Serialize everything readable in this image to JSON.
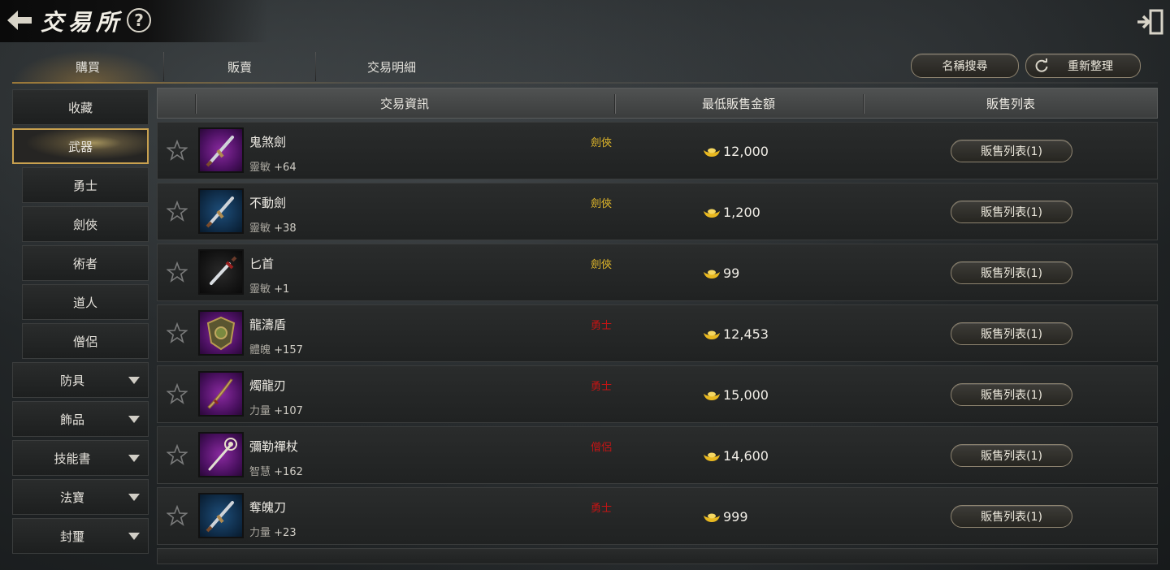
{
  "header": {
    "title": "交易所",
    "back_icon": "back-arrow-icon",
    "help_label": "?",
    "exit_icon": "exit-icon"
  },
  "tabs": [
    {
      "label": "購買",
      "active": true
    },
    {
      "label": "販賣",
      "active": false
    },
    {
      "label": "交易明細",
      "active": false
    }
  ],
  "actions": {
    "search_label": "名稱搜尋",
    "refresh_label": "重新整理",
    "refresh_icon": "refresh-icon"
  },
  "sidebar": {
    "items": [
      {
        "label": "收藏",
        "sub": false,
        "active": false,
        "caret": false
      },
      {
        "label": "武器",
        "sub": false,
        "active": true,
        "caret": false
      },
      {
        "label": "勇士",
        "sub": true,
        "active": false,
        "caret": false
      },
      {
        "label": "劍俠",
        "sub": true,
        "active": false,
        "caret": false
      },
      {
        "label": "術者",
        "sub": true,
        "active": false,
        "caret": false
      },
      {
        "label": "道人",
        "sub": true,
        "active": false,
        "caret": false
      },
      {
        "label": "僧侶",
        "sub": true,
        "active": false,
        "caret": false
      },
      {
        "label": "防具",
        "sub": false,
        "active": false,
        "caret": true
      },
      {
        "label": "飾品",
        "sub": false,
        "active": false,
        "caret": true
      },
      {
        "label": "技能書",
        "sub": false,
        "active": false,
        "caret": true
      },
      {
        "label": "法寶",
        "sub": false,
        "active": false,
        "caret": true
      },
      {
        "label": "封璽",
        "sub": false,
        "active": false,
        "caret": true
      }
    ]
  },
  "table": {
    "headers": {
      "info": "交易資訊",
      "price": "最低販售金額",
      "list": "販售列表"
    },
    "colors": {
      "swordsman": "#e0b72a",
      "warrior": "#c41414",
      "monk": "#c41414"
    },
    "rows": [
      {
        "name": "鬼煞劍",
        "stat_label": "靈敏",
        "stat_value": "+64",
        "class": "劍俠",
        "class_color": "#e0b72a",
        "price": "12,000",
        "button": "販售列表(1)",
        "thumb": "purple",
        "icon": "sword-icon"
      },
      {
        "name": "不動劍",
        "stat_label": "靈敏",
        "stat_value": "+38",
        "class": "劍俠",
        "class_color": "#e0b72a",
        "price": "1,200",
        "button": "販售列表(1)",
        "thumb": "blue",
        "icon": "sword-icon"
      },
      {
        "name": "匕首",
        "stat_label": "靈敏",
        "stat_value": "+1",
        "class": "劍俠",
        "class_color": "#e0b72a",
        "price": "99",
        "button": "販售列表(1)",
        "thumb": "black",
        "icon": "dagger-icon"
      },
      {
        "name": "龍濤盾",
        "stat_label": "體魄",
        "stat_value": "+157",
        "class": "勇士",
        "class_color": "#c41414",
        "price": "12,453",
        "button": "販售列表(1)",
        "thumb": "purple",
        "icon": "shield-icon"
      },
      {
        "name": "燭龍刃",
        "stat_label": "力量",
        "stat_value": "+107",
        "class": "勇士",
        "class_color": "#c41414",
        "price": "15,000",
        "button": "販售列表(1)",
        "thumb": "purple",
        "icon": "blade-icon"
      },
      {
        "name": "彌勒禪杖",
        "stat_label": "智慧",
        "stat_value": "+162",
        "class": "僧侶",
        "class_color": "#c41414",
        "price": "14,600",
        "button": "販售列表(1)",
        "thumb": "purple",
        "icon": "staff-icon"
      },
      {
        "name": "奪魄刀",
        "stat_label": "力量",
        "stat_value": "+23",
        "class": "勇士",
        "class_color": "#c41414",
        "price": "999",
        "button": "販售列表(1)",
        "thumb": "blue",
        "icon": "sword-icon"
      }
    ],
    "ingot_icon": "gold-ingot-icon",
    "star_icon": "star-icon"
  }
}
